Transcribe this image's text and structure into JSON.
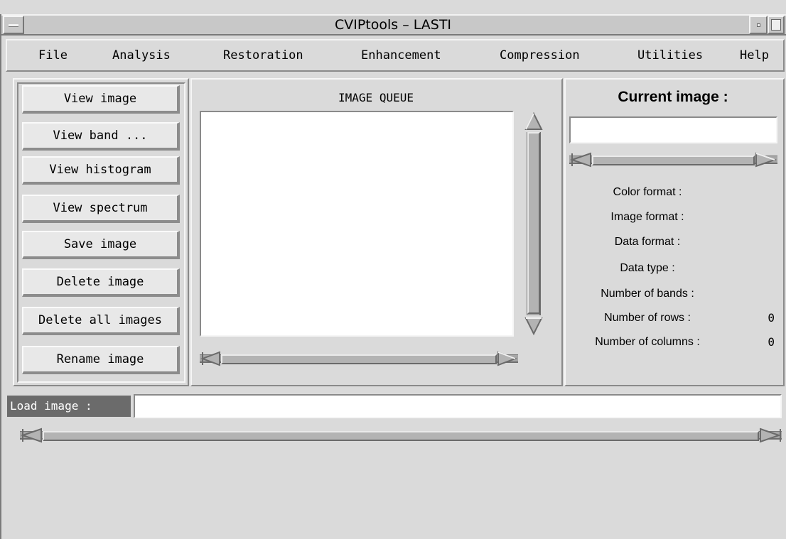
{
  "window": {
    "title": "CVIPtools – LASTI",
    "menu_button_icon": "window-menu-icon",
    "minimize_icon": "minimize-icon",
    "maximize_icon": "maximize-icon"
  },
  "menubar": {
    "items": [
      "File",
      "Analysis",
      "Restoration",
      "Enhancement",
      "Compression",
      "Utilities",
      "Help"
    ]
  },
  "left_panel": {
    "buttons": [
      "View image",
      "View band ...",
      "View histogram",
      "View spectrum",
      "Save image",
      "Delete image",
      "Delete all images",
      "Rename image"
    ]
  },
  "queue": {
    "title": "IMAGE QUEUE",
    "items": []
  },
  "current": {
    "title": "Current image :",
    "value": "",
    "labels": {
      "color_format": "Color format :",
      "image_format": "Image format :",
      "data_format": "Data format :",
      "data_type": "Data type :",
      "bands": "Number of bands :",
      "rows": "Number of rows :",
      "columns": "Number of columns :"
    },
    "values": {
      "rows": "0",
      "columns": "0"
    }
  },
  "load": {
    "label": "Load image :",
    "value": ""
  },
  "icons": {
    "arrow_left": "arrow-left-icon",
    "arrow_right": "arrow-right-icon",
    "arrow_up": "arrow-up-icon",
    "arrow_down": "arrow-down-icon"
  }
}
